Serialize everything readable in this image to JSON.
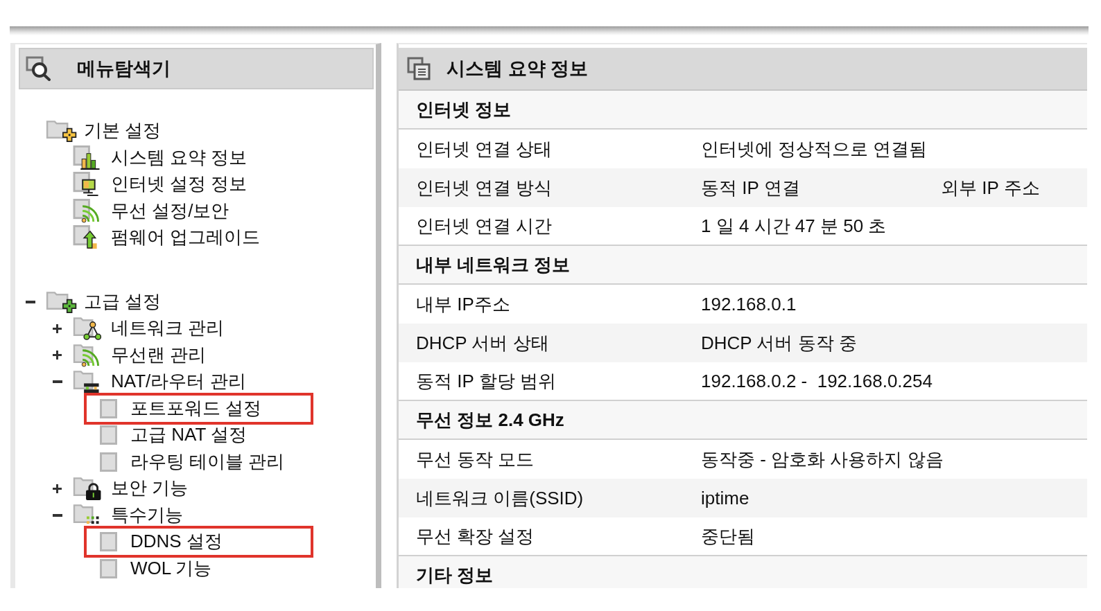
{
  "sidebar": {
    "title": "메뉴탐색기",
    "tree": [
      {
        "label": "기본 설정",
        "highlighted": false,
        "children": [
          {
            "label": "시스템 요약 정보",
            "highlighted": false
          },
          {
            "label": "인터넷 설정 정보",
            "highlighted": false
          },
          {
            "label": "무선 설정/보안",
            "highlighted": false
          },
          {
            "label": "펌웨어 업그레이드",
            "highlighted": false
          }
        ]
      },
      {
        "label": "고급 설정",
        "expanded": true,
        "highlighted": false,
        "children": [
          {
            "label": "네트워크 관리",
            "expanded": false,
            "highlighted": false
          },
          {
            "label": "무선랜 관리",
            "expanded": false,
            "highlighted": false
          },
          {
            "label": "NAT/라우터 관리",
            "expanded": true,
            "highlighted": false,
            "children": [
              {
                "label": "포트포워드 설정",
                "highlighted": true
              },
              {
                "label": "고급 NAT 설정",
                "highlighted": false
              },
              {
                "label": "라우팅 테이블 관리",
                "highlighted": false
              }
            ]
          },
          {
            "label": "보안 기능",
            "expanded": false,
            "highlighted": false
          },
          {
            "label": "특수기능",
            "expanded": true,
            "highlighted": false,
            "children": [
              {
                "label": "DDNS 설정",
                "highlighted": true
              },
              {
                "label": "WOL 기능",
                "highlighted": false
              }
            ]
          }
        ]
      }
    ]
  },
  "main": {
    "title": "시스템 요약 정보",
    "sections": [
      {
        "title": "인터넷 정보",
        "rows": [
          {
            "label": "인터넷 연결 상태",
            "value": "인터넷에 정상적으로 연결됨"
          },
          {
            "label": "인터넷 연결 방식",
            "value": "동적 IP 연결",
            "column_3": "외부 IP 주소"
          },
          {
            "label": "인터넷 연결 시간",
            "value": "1 일 4 시간 47 분 50 초"
          }
        ]
      },
      {
        "title": "내부 네트워크 정보",
        "rows": [
          {
            "label": "내부 IP주소",
            "value": "192.168.0.1"
          },
          {
            "label": "DHCP 서버 상태",
            "value": "DHCP 서버 동작 중"
          },
          {
            "label": "동적 IP 할당 범위",
            "value": "192.168.0.2 -  192.168.0.254"
          }
        ]
      },
      {
        "title": "무선 정보 2.4 GHz",
        "rows": [
          {
            "label": "무선 동작 모드",
            "value": "동작중 - 암호화 사용하지 않음"
          },
          {
            "label": "네트워크 이름(SSID)",
            "value": "iptime"
          },
          {
            "label": "무선 확장 설정",
            "value": "중단됨"
          }
        ]
      },
      {
        "title": "기타 정보"
      }
    ]
  }
}
